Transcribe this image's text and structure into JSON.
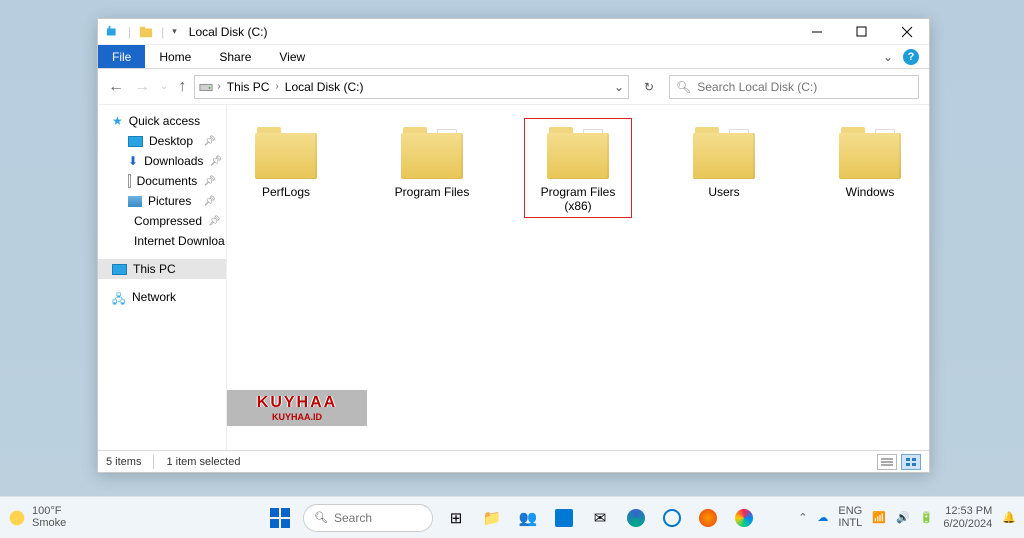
{
  "title": "Local Disk (C:)",
  "ribbon": {
    "file": "File",
    "home": "Home",
    "share": "Share",
    "view": "View"
  },
  "breadcrumb": [
    "This PC",
    "Local Disk (C:)"
  ],
  "search_placeholder": "Search Local Disk (C:)",
  "sidebar": {
    "quick": "Quick access",
    "items": [
      "Desktop",
      "Downloads",
      "Documents",
      "Pictures",
      "Compressed",
      "Internet Downloa"
    ],
    "thispc": "This PC",
    "network": "Network"
  },
  "folders": [
    {
      "name": "PerfLogs",
      "papers": false,
      "selected": false
    },
    {
      "name": "Program Files",
      "papers": true,
      "selected": false
    },
    {
      "name": "Program Files (x86)",
      "papers": true,
      "selected": true
    },
    {
      "name": "Users",
      "papers": true,
      "selected": false
    },
    {
      "name": "Windows",
      "papers": true,
      "selected": false
    }
  ],
  "status": {
    "count": "5 items",
    "selected": "1 item selected"
  },
  "watermark": {
    "big": "KUYHAA",
    "small": "KUYHAA.ID"
  },
  "taskbar": {
    "weather_temp": "100°F",
    "weather_cond": "Smoke",
    "search": "Search",
    "lang1": "ENG",
    "lang2": "INTL",
    "time": "12:53 PM",
    "date": "6/20/2024"
  }
}
